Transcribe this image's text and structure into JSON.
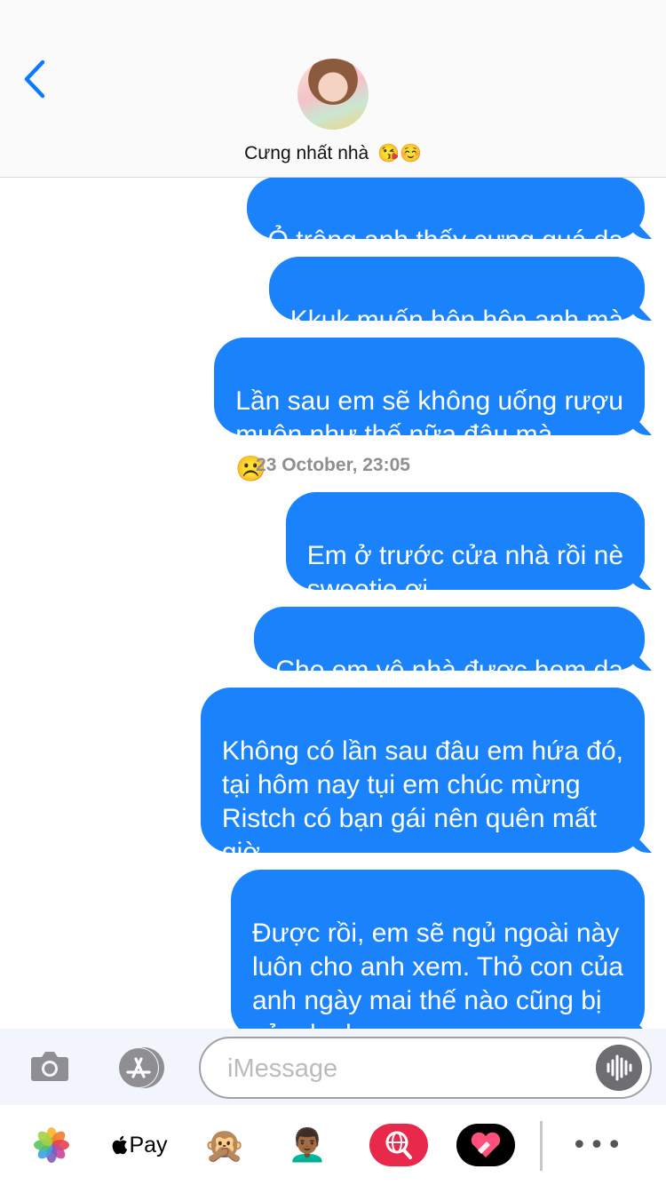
{
  "header": {
    "contact_name": "Cưng nhất nhà",
    "contact_emojis": "😘☺️"
  },
  "thread": {
    "messages": [
      {
        "text": "Ỏ trông anh thấy cưng quá dạ",
        "emoji": ""
      },
      {
        "text": "Kkuk muốn hôn hôn anh mà",
        "emoji": ""
      },
      {
        "text": "Lần sau em sẽ không uống rượu\nmuộn như thế nữa đâu mà",
        "emoji": "☹️"
      },
      {
        "text": "Em ở trước cửa nhà rồi nè\nsweetie ơi",
        "emoji": ""
      },
      {
        "text": "Cho em vô nhà được hem dạ",
        "emoji": "🤗"
      },
      {
        "text": "Không có lần sau đâu em hứa đó,\ntại hôm nay tụi em chúc mừng\nRistch có bạn gái nên quên mất\ngiờ",
        "emoji": ""
      },
      {
        "text": "Được rồi, em sẽ ngủ ngoài này\nluôn cho anh xem. Thỏ con của\nanh ngày mai thế nào cũng bị\ncảm lạnh",
        "emoji": "😞"
      }
    ],
    "timestamp": "23 October, 23:05"
  },
  "input": {
    "placeholder": "iMessage"
  },
  "drawer": {
    "apple_pay_label": "Pay",
    "more_label": "•••",
    "monkey_emoji": "🙊",
    "memoji": "👨🏾‍🦱",
    "icons": [
      "photos-icon",
      "apple-pay-icon",
      "animoji-icon",
      "memoji-stickers-icon",
      "web-search-icon",
      "digital-touch-icon",
      "more-icon"
    ]
  },
  "colors": {
    "bubble": "#1a82fb",
    "accent": "#0a7aff",
    "battery": "#4cd964"
  }
}
